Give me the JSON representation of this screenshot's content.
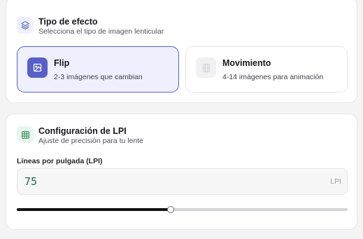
{
  "effect_section": {
    "title": "Tipo de efecto",
    "subtitle": "Selecciona el tipo de imagen lenticular",
    "icon": "layers-icon",
    "options": [
      {
        "title": "Flip",
        "description": "2-3 imágenes que cambian",
        "icon": "flip-image-icon",
        "selected": true
      },
      {
        "title": "Movimiento",
        "description": "4-14 imágenes para animación",
        "icon": "film-icon",
        "selected": false
      }
    ]
  },
  "lpi_section": {
    "title": "Configuración de LPI",
    "subtitle": "Ajuste de precisión para tu lente",
    "icon": "grid-icon",
    "field_label": "Líneas por pulgada (LPI)",
    "value": "75",
    "unit": "LPI",
    "slider_fraction": 0.465
  },
  "colors": {
    "accent": "#5a5ec9",
    "selected_bg": "#eef0fd",
    "lpi_icon_bg": "#e9f5ee",
    "lpi_value": "#1f6b4a"
  }
}
